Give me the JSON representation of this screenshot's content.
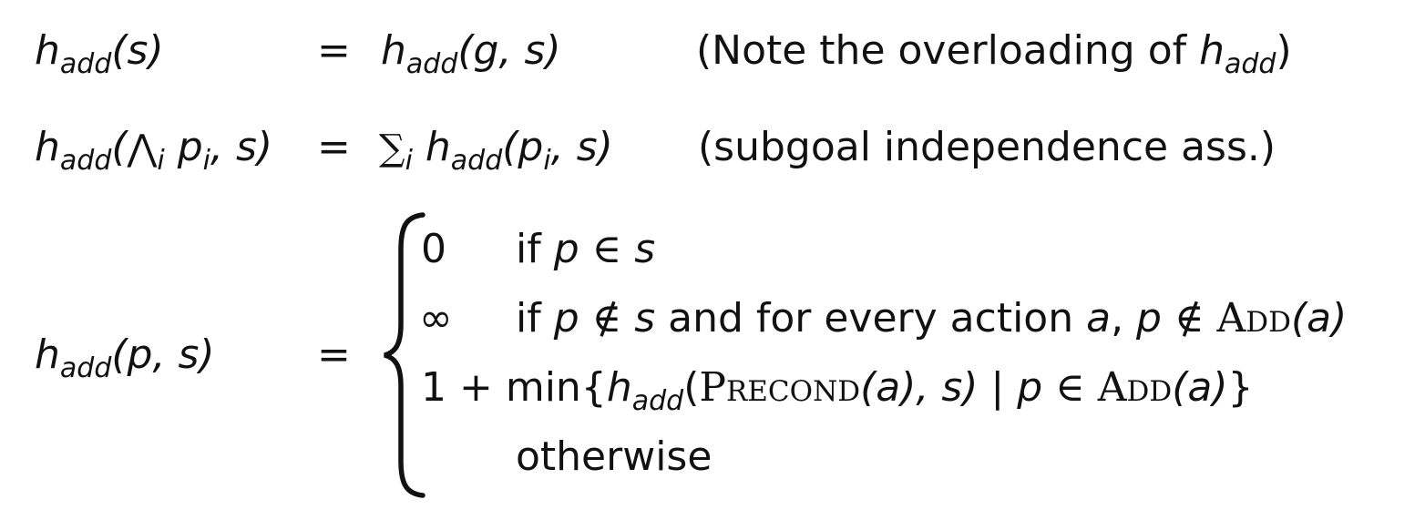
{
  "rows": [
    {
      "lhs_h": "h",
      "lhs_sub": "add",
      "lhs_args": "(s)",
      "eq": "=",
      "rhs_h": "h",
      "rhs_sub": "add",
      "rhs_args": "(g, s)",
      "note_open": "(Note the overloading of ",
      "note_h": "h",
      "note_sub": "add",
      "note_close": ")"
    },
    {
      "lhs_h": "h",
      "lhs_sub": "add",
      "lhs_open": "(",
      "wedge": "⋀",
      "wedge_sub": "i",
      "lhs_p": " p",
      "lhs_p_sub": "i",
      "lhs_close": ", s)",
      "eq": "=",
      "sum": "∑",
      "sum_sub": "i",
      "rhs_h": " h",
      "rhs_sub": "add",
      "rhs_open": "(p",
      "rhs_p_sub": "i",
      "rhs_close": ", s)",
      "note": "(subgoal independence ass.)"
    },
    {
      "lhs_h": "h",
      "lhs_sub": "add",
      "lhs_args": "(p, s)",
      "eq": "="
    }
  ],
  "cases": [
    {
      "value": "0",
      "cond_if": "if ",
      "cond_p": "p",
      "cond_in": " ∈ ",
      "cond_s": "s"
    },
    {
      "value": "∞",
      "cond_if": "if ",
      "cond_p": "p",
      "cond_notin": " ∉ ",
      "cond_s": "s",
      "cond_mid": " and for every action ",
      "cond_a": "a",
      "cond_comma": ", ",
      "cond_p2": "p",
      "cond_notin2": " ∉ ",
      "cond_add": "Add",
      "cond_add_args": "(a)"
    },
    {
      "expr_start": "1 + min{",
      "expr_h": "h",
      "expr_sub": "add",
      "expr_paren": "(",
      "expr_precond": "Precond",
      "expr_a": "(a), s)",
      "expr_bar": " | ",
      "expr_p": "p",
      "expr_in": " ∈ ",
      "expr_add": "Add",
      "expr_add_args": "(a)",
      "expr_end": "}"
    },
    {
      "cond": "otherwise"
    }
  ]
}
